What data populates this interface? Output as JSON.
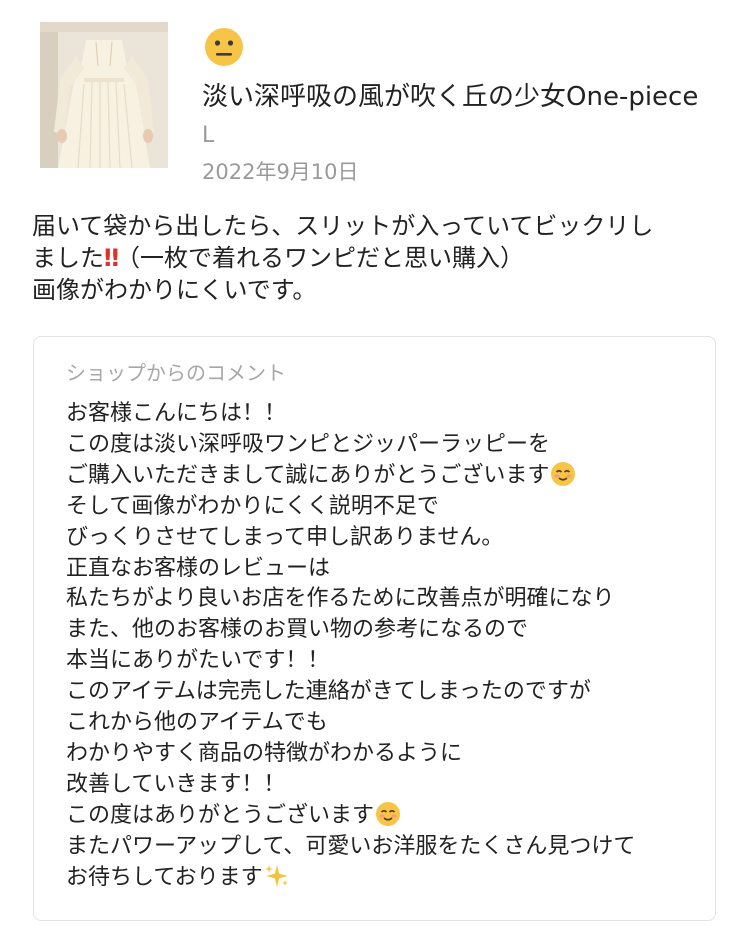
{
  "product": {
    "image_alt": "cream one-piece dress",
    "name": "淡い深呼吸の風が吹く丘の少女One-piece",
    "size": "L",
    "date": "2022年9月10日",
    "rating_icon": "neutral-face-icon"
  },
  "review": {
    "lines": [
      "届いて袋から出したら、スリットが入っていてビックリし",
      "ました",
      "（一枚で着れるワンピだと思い購入）",
      "画像がわかりにくいです。"
    ],
    "exclamation": "‼"
  },
  "shop_comment": {
    "heading": "ショップからのコメント",
    "lines": [
      "お客様こんにちは！！",
      "この度は淡い深呼吸ワンピとジッパーラッピーを",
      "ご購入いただきまして誠にありがとうございます",
      "そして画像がわかりにくく説明不足で",
      "びっくりさせてしまって申し訳ありません。",
      "正直なお客様のレビューは",
      "私たちがより良いお店を作るために改善点が明確になり",
      "また、他のお客様のお買い物の参考になるので",
      "本当にありがたいです！！",
      "このアイテムは完売した連絡がきてしまったのですが",
      "これから他のアイテムでも",
      "わかりやすく商品の特徴がわかるように",
      "改善していきます！！",
      "この度はありがとうございます",
      "またパワーアップして、可愛いお洋服をたくさん見つけて",
      "お待ちしております"
    ],
    "icons": {
      "smile": "smiling-face-icon",
      "sparkles": "sparkles-icon"
    }
  }
}
